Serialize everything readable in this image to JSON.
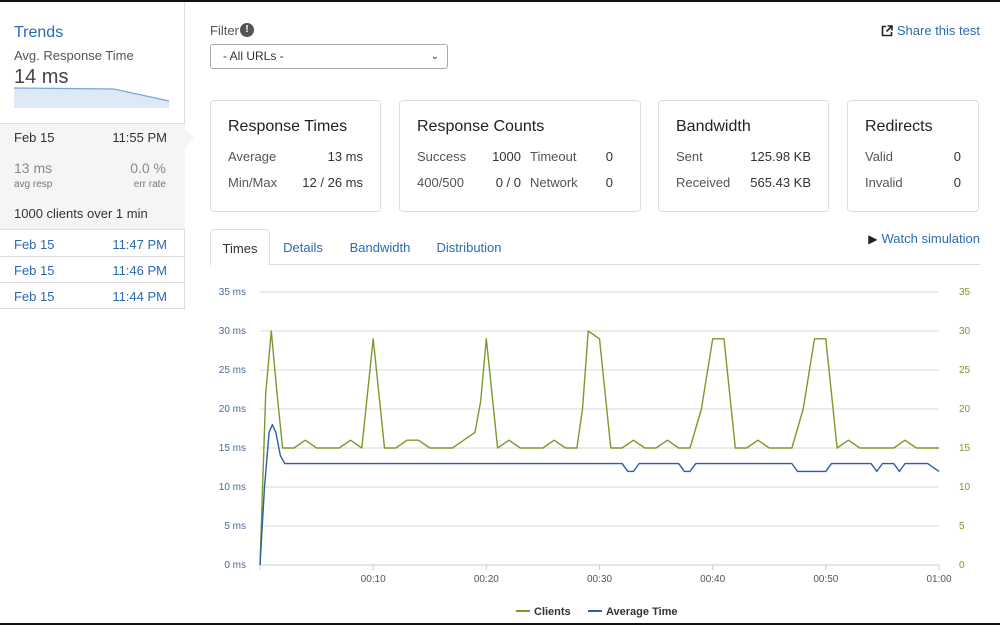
{
  "sidebar": {
    "title": "Trends",
    "metric_label": "Avg. Response Time",
    "metric_value": "14 ms",
    "current": {
      "date": "Feb 15",
      "time": "11:55 PM",
      "avg_resp_value": "13 ms",
      "avg_resp_label": "avg resp",
      "err_rate_value": "0.0 %",
      "err_rate_label": "err rate",
      "summary": "1000 clients over 1 min"
    },
    "runs": [
      {
        "date": "Feb 15",
        "time": "11:47 PM"
      },
      {
        "date": "Feb 15",
        "time": "11:46 PM"
      },
      {
        "date": "Feb 15",
        "time": "11:44 PM"
      }
    ]
  },
  "filter": {
    "label": "Filter",
    "info_icon": "!",
    "selected": "- All URLs -"
  },
  "share_label": "Share this test",
  "cards": {
    "response_times": {
      "title": "Response Times",
      "average_label": "Average",
      "average_value": "13 ms",
      "minmax_label": "Min/Max",
      "minmax_value": "12 / 26 ms"
    },
    "response_counts": {
      "title": "Response Counts",
      "success_label": "Success",
      "success_value": "1000",
      "timeout_label": "Timeout",
      "timeout_value": "0",
      "err_label": "400/500",
      "err_value": "0 / 0",
      "network_label": "Network",
      "network_value": "0"
    },
    "bandwidth": {
      "title": "Bandwidth",
      "sent_label": "Sent",
      "sent_value": "125.98 KB",
      "received_label": "Received",
      "received_value": "565.43 KB"
    },
    "redirects": {
      "title": "Redirects",
      "valid_label": "Valid",
      "valid_value": "0",
      "invalid_label": "Invalid",
      "invalid_value": "0"
    }
  },
  "tabs": [
    "Times",
    "Details",
    "Bandwidth",
    "Distribution"
  ],
  "watch_label": "Watch simulation",
  "colors": {
    "clients": "#7a9a2a",
    "average_time": "#2d5da8"
  },
  "chart_data": {
    "type": "line",
    "x_ticks": [
      "00:10",
      "00:20",
      "00:30",
      "00:40",
      "00:50",
      "01:00"
    ],
    "y_left_ticks": [
      "0 ms",
      "5 ms",
      "10 ms",
      "15 ms",
      "20 ms",
      "25 ms",
      "30 ms",
      "35 ms"
    ],
    "y_right_ticks": [
      "0",
      "5",
      "10",
      "15",
      "20",
      "25",
      "30",
      "35"
    ],
    "ylim": [
      0,
      35
    ],
    "xlim": [
      0,
      60
    ],
    "grid": true,
    "legend_position": "bottom",
    "series": [
      {
        "name": "Clients",
        "axis": "right",
        "x": [
          0,
          0.5,
          1,
          1.5,
          2,
          3,
          4,
          5,
          7,
          8,
          9,
          10,
          11,
          12,
          13,
          14,
          15,
          16,
          17,
          18,
          19,
          19.5,
          20,
          21,
          22,
          23,
          24,
          25,
          26,
          27,
          28,
          28.5,
          29,
          30,
          31,
          32,
          33,
          34,
          35,
          36,
          37,
          38,
          39,
          40,
          41,
          42,
          43,
          44,
          45,
          46,
          47,
          48,
          49,
          50,
          51,
          52,
          53,
          54,
          55,
          56,
          57,
          58,
          59,
          60
        ],
        "y": [
          0,
          22,
          30,
          22,
          15,
          15,
          16,
          15,
          15,
          16,
          15,
          29,
          15,
          15,
          16,
          16,
          15,
          15,
          15,
          16,
          17,
          21,
          29,
          15,
          16,
          15,
          15,
          15,
          16,
          15,
          15,
          20,
          30,
          29,
          15,
          15,
          16,
          15,
          15,
          16,
          15,
          15,
          20,
          29,
          29,
          15,
          15,
          16,
          15,
          15,
          15,
          20,
          29,
          29,
          15,
          16,
          15,
          15,
          15,
          15,
          16,
          15,
          15,
          15
        ]
      },
      {
        "name": "Average Time",
        "axis": "left",
        "x": [
          0,
          0.4,
          0.8,
          1.1,
          1.4,
          1.8,
          2.2,
          3,
          10,
          20,
          30,
          32,
          32.5,
          33,
          33.5,
          35,
          37,
          37.5,
          38,
          38.5,
          40,
          47,
          47.5,
          48,
          50,
          50.5,
          51,
          53,
          54,
          54.5,
          55,
          56,
          56.5,
          57,
          58,
          59,
          60
        ],
        "y": [
          0,
          10,
          17,
          18,
          17,
          14,
          13,
          13,
          13,
          13,
          13,
          13,
          12,
          12,
          13,
          13,
          13,
          12,
          12,
          13,
          13,
          13,
          12,
          12,
          12,
          13,
          13,
          13,
          13,
          12,
          13,
          13,
          12,
          13,
          13,
          13,
          12
        ]
      }
    ]
  }
}
